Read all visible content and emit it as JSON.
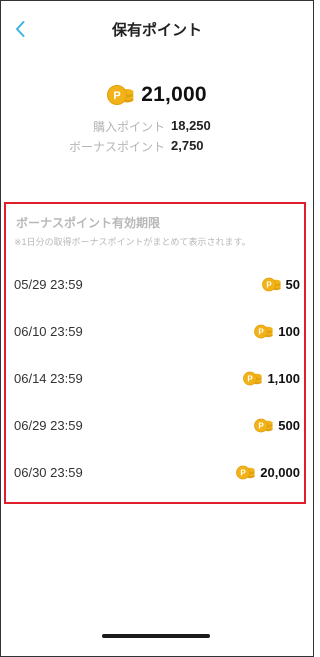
{
  "header": {
    "title": "保有ポイント",
    "back_icon": "chevron-left-icon"
  },
  "summary": {
    "total": "21,000",
    "purchased_label": "購入ポイント",
    "purchased_value": "18,250",
    "bonus_label": "ボーナスポイント",
    "bonus_value": "2,750"
  },
  "bonus_expiry": {
    "title": "ボーナスポイント有効期限",
    "note": "※1日分の取得ボーナスポイントがまとめて表示されます。",
    "items": [
      {
        "date": "05/29 23:59",
        "points": "50"
      },
      {
        "date": "06/10 23:59",
        "points": "100"
      },
      {
        "date": "06/14 23:59",
        "points": "1,100"
      },
      {
        "date": "06/29 23:59",
        "points": "500"
      },
      {
        "date": "06/30 23:59",
        "points": "20,000"
      }
    ]
  },
  "colors": {
    "accent": "#3bb3e6",
    "coin": "#f2b318",
    "highlight_border": "#e01e2b",
    "muted_text": "#b8b8b8"
  }
}
